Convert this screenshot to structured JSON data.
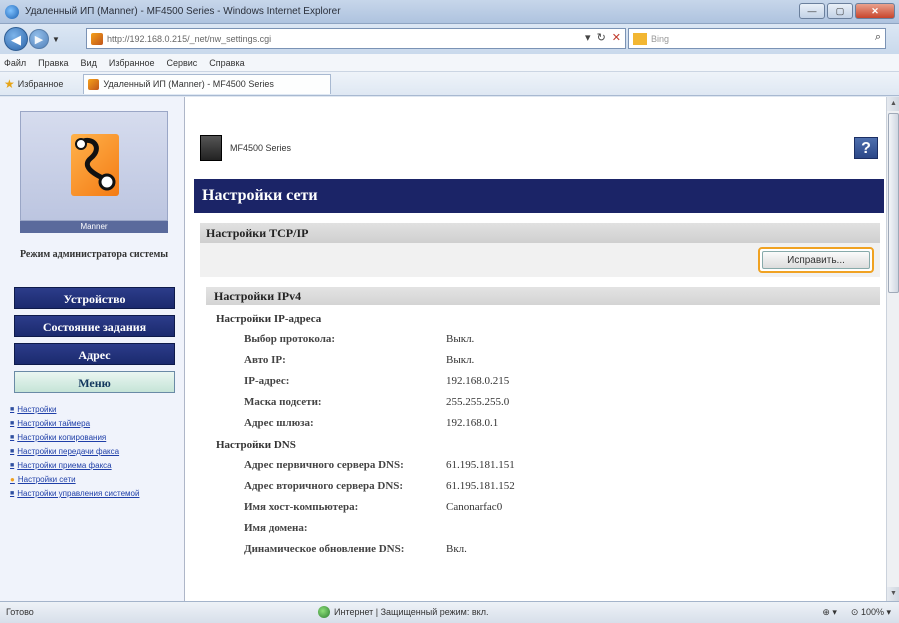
{
  "browser": {
    "window_title": "Удаленный ИП (Manner) - MF4500 Series - Windows Internet Explorer",
    "address": "http://192.168.0.215/_net/nw_settings.cgi",
    "search_placeholder": "Bing",
    "menu": [
      "Файл",
      "Правка",
      "Вид",
      "Избранное",
      "Сервис",
      "Справка"
    ],
    "favorites_label": "Избранное",
    "tab_label": "Удаленный ИП (Manner) - MF4500 Series"
  },
  "sidebar": {
    "logo_caption": "Manner",
    "admin_mode": "Режим администратора системы",
    "buttons": [
      "Устройство",
      "Состояние задания",
      "Адрес",
      "Меню"
    ],
    "links": [
      "Настройки",
      "Настройки таймера",
      "Настройки копирования",
      "Настройки передачи факса",
      "Настройки приема факса",
      "Настройки сети",
      "Настройки управления системой"
    ]
  },
  "main": {
    "model_name": "MF4500 Series",
    "help_label": "?",
    "page_title": "Настройки сети",
    "section_title": "Настройки TCP/IP",
    "edit_button": "Исправить...",
    "ipv4_title": "Настройки IPv4",
    "ip_group": {
      "title": "Настройки IP-адреса",
      "rows": [
        {
          "label": "Выбор протокола:",
          "value": "Выкл."
        },
        {
          "label": "Авто IP:",
          "value": "Выкл."
        },
        {
          "label": "IP-адрес:",
          "value": "192.168.0.215"
        },
        {
          "label": "Маска подсети:",
          "value": "255.255.255.0"
        },
        {
          "label": "Адрес шлюза:",
          "value": "192.168.0.1"
        }
      ]
    },
    "dns_group": {
      "title": "Настройки DNS",
      "rows": [
        {
          "label": "Адрес первичного сервера DNS:",
          "value": "61.195.181.151"
        },
        {
          "label": "Адрес вторичного сервера DNS:",
          "value": "61.195.181.152"
        },
        {
          "label": "Имя хост-компьютера:",
          "value": "Canonarfac0"
        },
        {
          "label": "Имя домена:",
          "value": ""
        },
        {
          "label": "Динамическое обновление DNS:",
          "value": "Вкл."
        }
      ]
    }
  },
  "statusbar": {
    "status": "Готово",
    "zone": "Интернет | Защищенный режим: вкл.",
    "zoom": "100%"
  }
}
